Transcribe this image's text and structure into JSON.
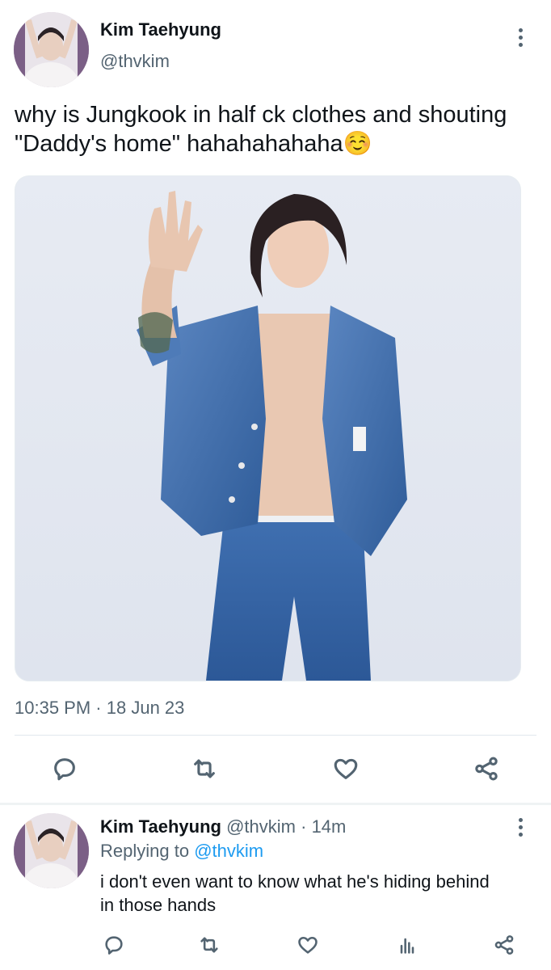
{
  "tweet": {
    "author_name": "Kim Taehyung",
    "author_handle": "@thvkim",
    "text": "why is Jungkook in half ck clothes and shouting \"Daddy's home\" hahahahahaha☺️",
    "time": "10:35 PM",
    "separator": "·",
    "date": "18 Jun 23",
    "media_alt": "Photo of a person in a denim jacket and jeans waving",
    "actions": [
      "reply-icon",
      "retweet-icon",
      "like-icon",
      "share-icon"
    ]
  },
  "reply": {
    "author_name": "Kim Taehyung",
    "author_handle": "@thvkim",
    "separator": "·",
    "age": "14m",
    "replying_prefix": "Replying to",
    "replying_handle": "@thvkim",
    "text": "i don't even want to know what he's hiding behind in those hands",
    "actions": [
      "reply-icon",
      "retweet-icon",
      "like-icon",
      "analytics-icon",
      "share-icon"
    ]
  },
  "colors": {
    "text": "#0f1419",
    "secondary": "#536471",
    "link": "#1d9bf0",
    "divider": "#e1e8ed"
  }
}
